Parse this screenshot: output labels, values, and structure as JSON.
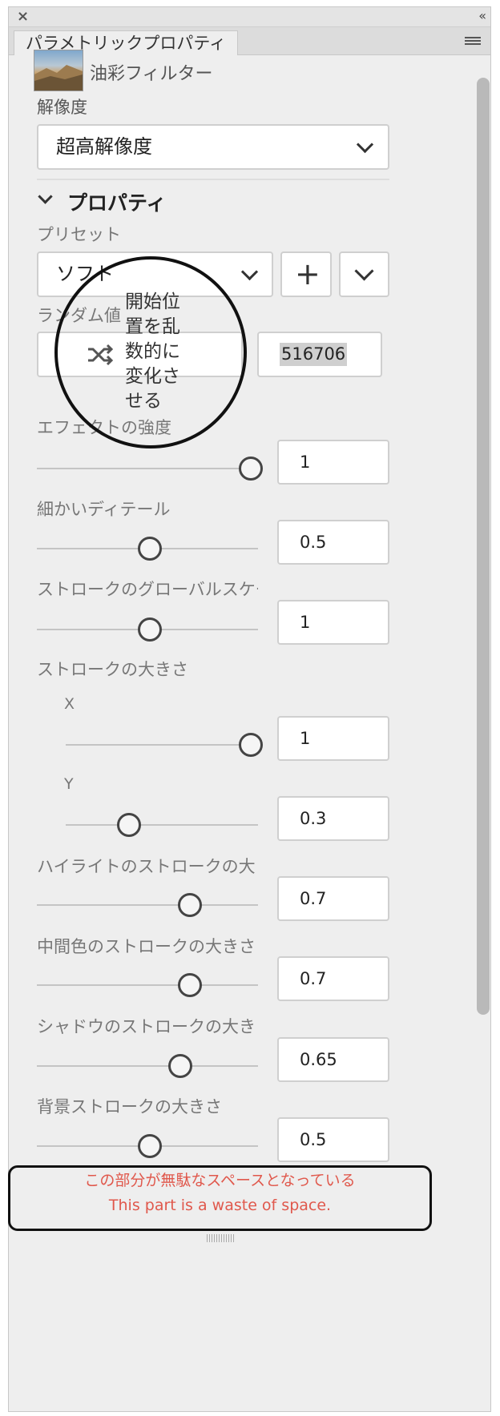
{
  "panel": {
    "tab_label": "パラメトリックプロパティ",
    "filter_name": "油彩フィルター",
    "resolution_label": "解像度",
    "resolution_value": "超高解像度",
    "section_title": "プロパティ",
    "preset_label": "プリセット",
    "preset_value": "ソフト",
    "add_button_symbol": "+",
    "random_label": "ランダム値",
    "random_seed": "516706",
    "callout_text": "開始位置を乱数的に変化させる",
    "callout_lines": [
      "開始位",
      "置を乱",
      "数的に",
      "変化さ",
      "せる"
    ]
  },
  "sliders": [
    {
      "label": "エフェクトの強度",
      "value": "1",
      "fraction": 1.0
    },
    {
      "label": "細かいディテール",
      "value": "0.5",
      "fraction": 0.5
    },
    {
      "label": "ストロークのグローバルスケー",
      "value": "1",
      "fraction": 0.5
    },
    {
      "label": "ストロークの大きさ",
      "value": "",
      "fraction": null
    },
    {
      "label": "X",
      "value": "1",
      "fraction": 1.0
    },
    {
      "label": "Y",
      "value": "0.3",
      "fraction": 0.3
    },
    {
      "label": "ハイライトのストロークの大き",
      "value": "0.7",
      "fraction": 0.7
    },
    {
      "label": "中間色のストロークの大きさ",
      "value": "0.7",
      "fraction": 0.7
    },
    {
      "label": "シャドウのストロークの大き",
      "value": "0.65",
      "fraction": 0.65
    },
    {
      "label": "背景ストロークの大きさ",
      "value": "0.5",
      "fraction": 0.5
    }
  ],
  "annotation": {
    "jp": "この部分が無駄なスペースとなっている",
    "en": "This part is a waste of space."
  },
  "colors": {
    "panel_bg": "#eeeeee",
    "annotation_text": "#e0584c"
  },
  "icons": {
    "close": "close-icon",
    "collapse": "double-chevron-left-icon",
    "menu": "hamburger-icon",
    "shuffle": "shuffle-icon",
    "dropdown": "chevron-down-icon"
  }
}
